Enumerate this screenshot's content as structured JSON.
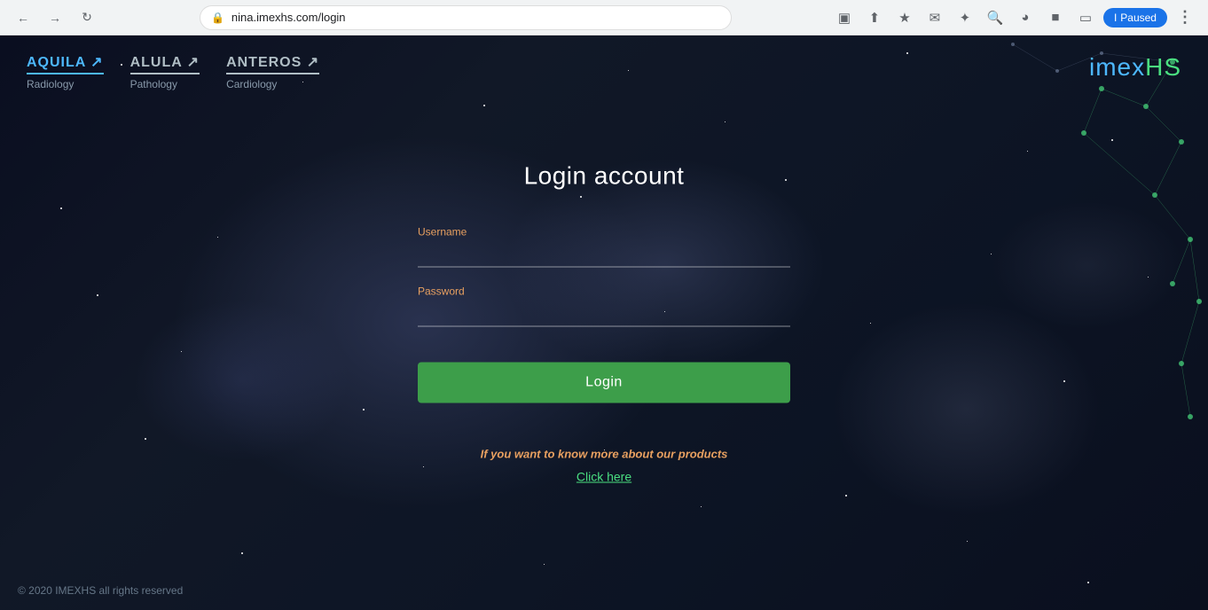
{
  "browser": {
    "url": "nina.imexhs.com/login",
    "paused_label": "Paused"
  },
  "header": {
    "products": [
      {
        "name": "AQUILA",
        "sub": "Radiology",
        "class": "aquila"
      },
      {
        "name": "ALULA",
        "sub": "Pathology",
        "class": "alula"
      },
      {
        "name": "ANTEROS",
        "sub": "Cardiology",
        "class": "anteros"
      }
    ],
    "logo": {
      "imex": "imex",
      "hs": "HS"
    }
  },
  "login": {
    "title": "Login account",
    "username_label": "Username",
    "password_label": "Password",
    "login_button": "Login",
    "info_text": "If you want to know more about our products",
    "click_here": "Click here"
  },
  "footer": {
    "copyright": "© 2020 IMEXHS all rights reserved"
  }
}
